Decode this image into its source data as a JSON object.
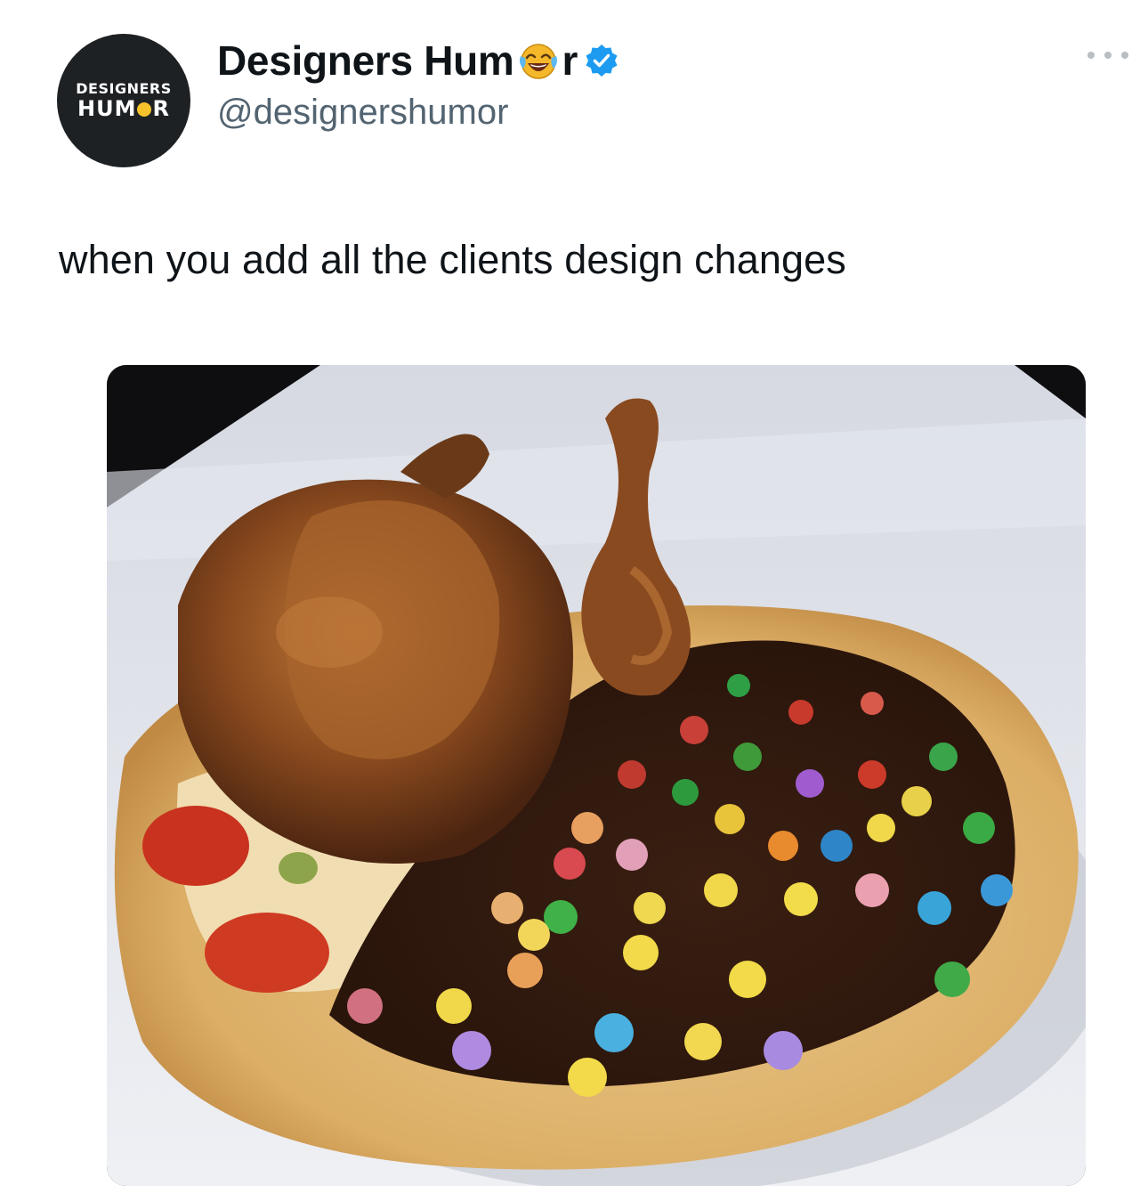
{
  "avatar": {
    "line1": "DESIGNERS",
    "line2_a": "HUM",
    "line2_b": "R"
  },
  "author": {
    "name_a": "Designers Hum",
    "name_b": "r",
    "handle": "@designershumor",
    "verified": true,
    "emoji_icon": "laughing-face-icon"
  },
  "tweet": {
    "text": "when you add all the clients design changes"
  },
  "media": {
    "description_icon": "food-photo"
  },
  "colors": {
    "verified_blue": "#1d9bf0",
    "handle_gray": "#536471",
    "avatar_bg": "#1e2124"
  }
}
